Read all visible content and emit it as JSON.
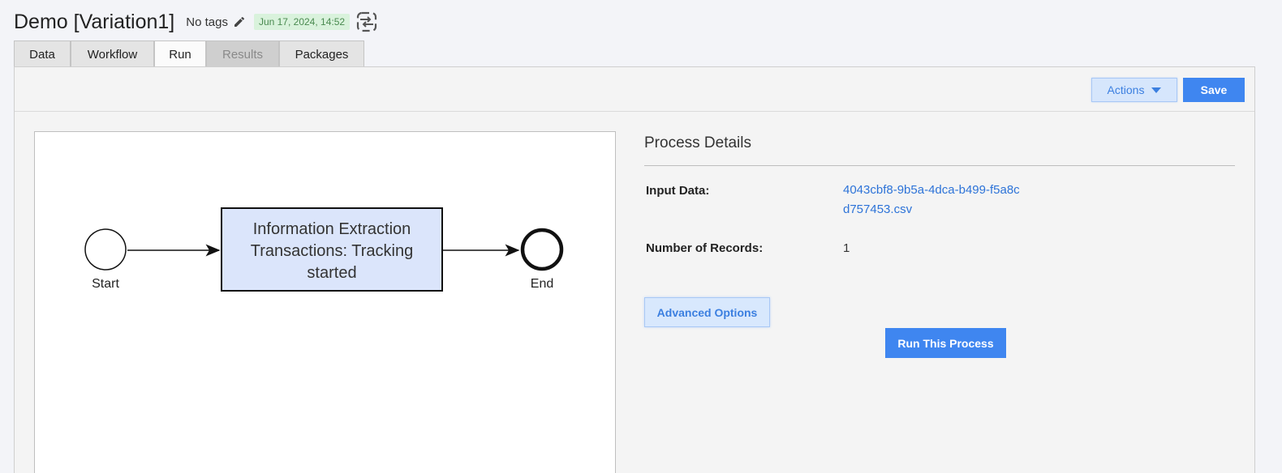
{
  "header": {
    "title": "Demo [Variation1]",
    "tags_label": "No tags",
    "date_badge": "Jun 17, 2024, 14:52"
  },
  "tabs": [
    {
      "label": "Data",
      "state": "normal"
    },
    {
      "label": "Workflow",
      "state": "normal"
    },
    {
      "label": "Run",
      "state": "active"
    },
    {
      "label": "Results",
      "state": "disabled"
    },
    {
      "label": "Packages",
      "state": "normal"
    }
  ],
  "toolbar": {
    "actions_label": "Actions",
    "save_label": "Save"
  },
  "workflow": {
    "start_label": "Start",
    "task_lines": [
      "Information Extraction",
      "Transactions: Tracking",
      "started"
    ],
    "end_label": "End"
  },
  "details": {
    "title": "Process Details",
    "input_data_label": "Input Data:",
    "input_data_value": "4043cbf8-9b5a-4dca-b499-f5a8cd757453.csv",
    "records_label": "Number of Records:",
    "records_value": "1",
    "advanced_label": "Advanced Options",
    "run_label": "Run This Process"
  },
  "colors": {
    "accent": "#3f86f0",
    "task_fill": "#dbe5fb",
    "badge_bg": "#d9f2dc"
  }
}
